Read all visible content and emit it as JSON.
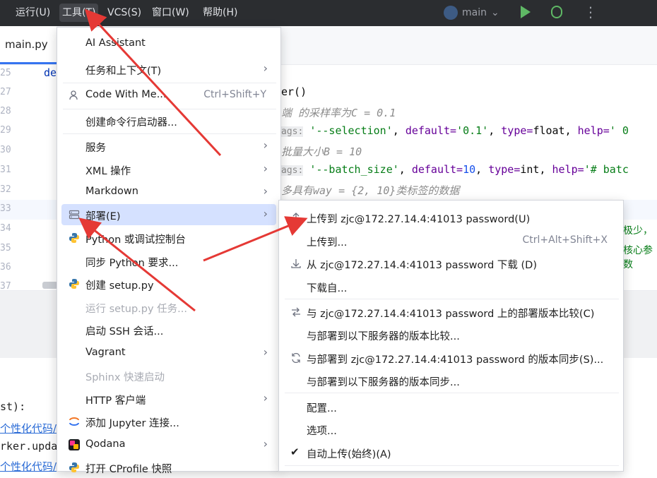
{
  "menubar": {
    "items": [
      "运行(U)",
      "工具(T)",
      "VCS(S)",
      "窗口(W)",
      "帮助(H)"
    ],
    "branch": "main"
  },
  "editor": {
    "tab": "main.py",
    "line_numbers": [
      "25",
      "27",
      "28",
      "29",
      "30",
      "31",
      "32",
      "33",
      "34",
      "35",
      "36",
      "37"
    ],
    "code": {
      "l25": "de",
      "l27": "er()",
      "l28": "端 的采样率为C = 0.1",
      "l29_hint": "ags:",
      "l29_a": "'--selection'",
      "l29_b": ", ",
      "l29_c": "default=",
      "l29_d": "'0.1'",
      "l29_e": ", ",
      "l29_f": "type=",
      "l29_g": "float",
      "l29_h": ", ",
      "l29_i": "help=",
      "l29_j": "' 0",
      "l30": "批量大小B = 10",
      "l31_hint": "ags:",
      "l31_a": "'--batch_size'",
      "l31_b": ", ",
      "l31_c": "default=",
      "l31_d": "10",
      "l31_e": ", ",
      "l31_f": "type=",
      "l31_g": "int",
      "l31_h": ", ",
      "l31_i": "help=",
      "l31_j": "'# batc",
      "l32": "多具有way = {2, 10}类标签的数据",
      "r34": "极少，",
      "r35": "核心参数"
    }
  },
  "console": {
    "line1": "st):",
    "line2": "个性化代码/",
    "line3": "rker.upda",
    "line4": "个性化代码/"
  },
  "tools_menu": {
    "items": [
      {
        "label": "AI Assistant"
      },
      {
        "label": "任务和上下文(T)",
        "arrow": "›"
      },
      {
        "label": "Code With Me...",
        "shortcut": "Ctrl+Shift+Y"
      },
      {
        "label": "创建命令行启动器..."
      },
      {
        "label": "服务",
        "arrow": "›"
      },
      {
        "label": "XML 操作",
        "arrow": "›"
      },
      {
        "label": "Markdown",
        "arrow": "›"
      },
      {
        "label": "部署(E)",
        "arrow": "›"
      },
      {
        "label": "Python 或调试控制台"
      },
      {
        "label": "同步 Python 要求..."
      },
      {
        "label": "创建 setup.py"
      },
      {
        "label": "运行 setup.py 任务..."
      },
      {
        "label": "启动 SSH 会话..."
      },
      {
        "label": "Vagrant",
        "arrow": "›"
      },
      {
        "label": "Sphinx 快速启动"
      },
      {
        "label": "HTTP 客户端",
        "arrow": "›"
      },
      {
        "label": "添加 Jupyter 连接..."
      },
      {
        "label": "Qodana",
        "arrow": "›"
      },
      {
        "label": "打开 CProfile 快照"
      }
    ]
  },
  "deploy_menu": {
    "items": [
      {
        "label": "上传到 zjc@172.27.14.4:41013 password(U)"
      },
      {
        "label": "上传到...",
        "shortcut": "Ctrl+Alt+Shift+X"
      },
      {
        "label": "从 zjc@172.27.14.4:41013 password 下载 (D)"
      },
      {
        "label": "下载自..."
      },
      {
        "label": "与 zjc@172.27.14.4:41013 password 上的部署版本比较(C)"
      },
      {
        "label": "与部署到以下服务器的版本比较..."
      },
      {
        "label": "与部署到 zjc@172.27.14.4:41013 password 的版本同步(S)..."
      },
      {
        "label": "与部署到以下服务器的版本同步..."
      },
      {
        "label": "配置..."
      },
      {
        "label": "选项..."
      },
      {
        "label": "自动上传(始终)(A)",
        "check": "✔"
      }
    ]
  },
  "colors": {
    "accent": "#3574f0",
    "highlight": "#d5e1ff",
    "annotation_arrow": "#e53935"
  }
}
